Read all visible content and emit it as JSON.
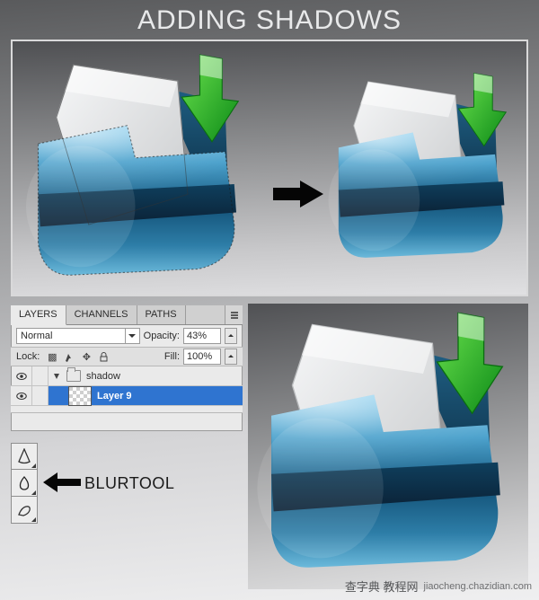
{
  "title": "ADDING SHADOWS",
  "mid_arrow_name": "arrow-right-icon",
  "layers_panel": {
    "tabs": {
      "layers": "LAYERS",
      "channels": "CHANNELS",
      "paths": "PATHS"
    },
    "menu_icon": "panel-menu-icon",
    "blend_mode": "Normal",
    "opacity_label": "Opacity:",
    "opacity_value": "43%",
    "lock_label": "Lock:",
    "fill_label": "Fill:",
    "fill_value": "100%",
    "group_name": "shadow",
    "selected_layer_name": "Layer 9"
  },
  "tools": {
    "sharpen": "sharpen-tool-icon",
    "blur": "blur-tool-icon",
    "smudge": "smudge-tool-icon",
    "blur_label": "BLURTOOL"
  },
  "watermark": {
    "cn": "查字典  教程网",
    "url": "jiaocheng.chazidian.com"
  }
}
